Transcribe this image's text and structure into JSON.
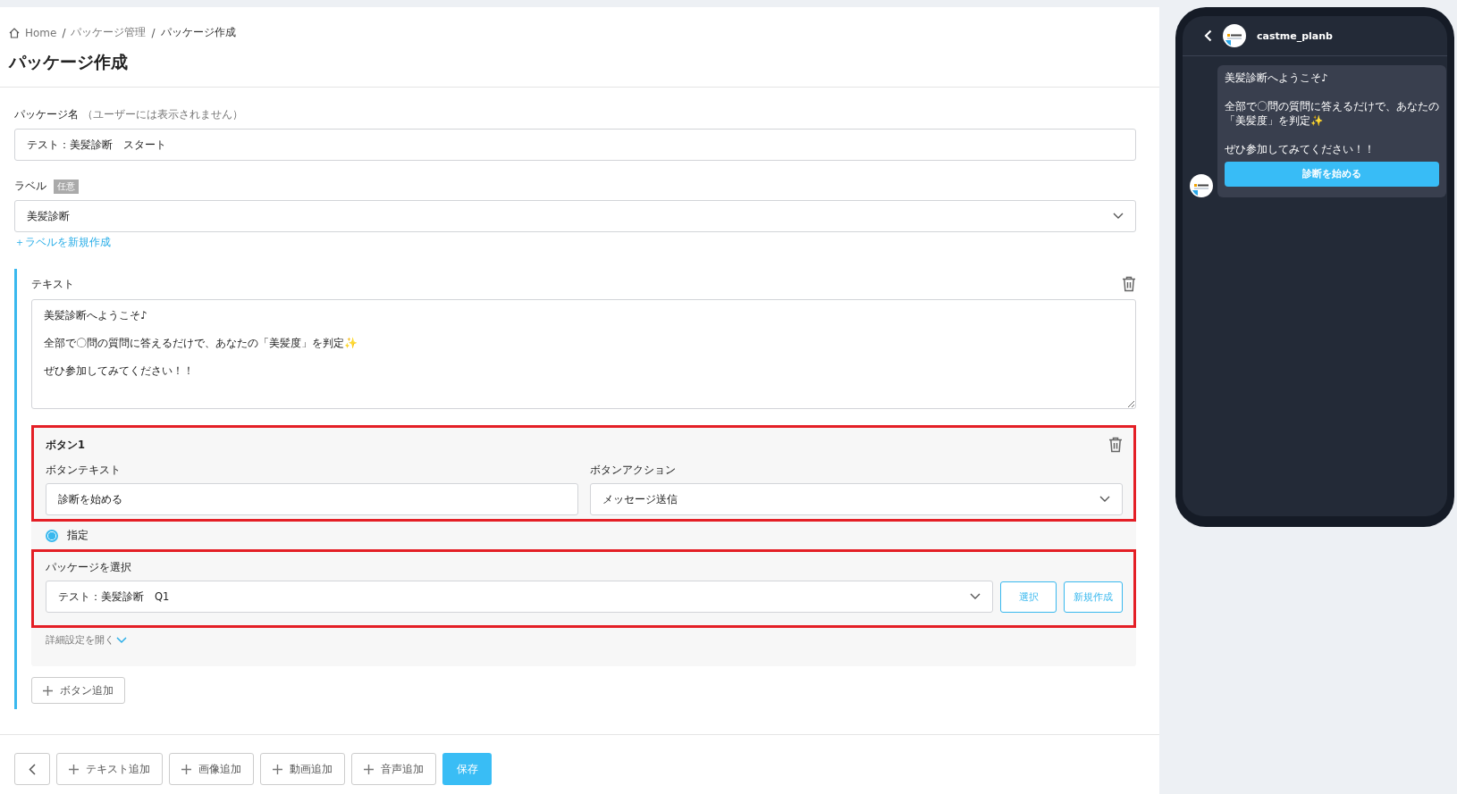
{
  "breadcrumb": [
    {
      "label": "Home"
    },
    {
      "separator": "/",
      "label": "パッケージ管理"
    },
    {
      "separator": "/",
      "label": "パッケージ作成"
    }
  ],
  "page_title": "パッケージ作成",
  "package_name": {
    "label": "パッケージ名",
    "hint": "（ユーザーには表示されません）",
    "value": "テスト：美髪診断　スタート"
  },
  "label_field": {
    "label": "ラベル",
    "badge": "任意",
    "value": "美髪診断",
    "create_link": "＋ラベルを新規作成"
  },
  "text_block": {
    "label": "テキスト",
    "value": "美髪診断へようこそ♪\n\n全部で〇問の質問に答えるだけで、あなたの「美髪度」を判定✨\n\nぜひ参加してみてください！！",
    "button_editor": {
      "title": "ボタン1",
      "highlighted": true,
      "text_label": "ボタンテキスト",
      "text_value": "診断を始める",
      "action_label": "ボタンアクション",
      "action_value": "メッセージ送信"
    },
    "radio": {
      "label": "指定",
      "selected": true
    },
    "package_select": {
      "highlighted": true,
      "label": "パッケージを選択",
      "value": "テスト：美髪診断　Q1",
      "buttons": [
        "選択",
        "新規作成"
      ]
    },
    "details_link": "詳細設定を開く",
    "add_button": "ボタン追加"
  },
  "footer": {
    "buttons": [
      "テキスト追加",
      "画像追加",
      "動画追加",
      "音声追加"
    ],
    "save": "保存"
  },
  "preview": {
    "account": "castme_planb",
    "message": [
      [
        "美髪診断へようこそ♪"
      ],
      [
        "全部で〇問の質問に答えるだけで、あなたの",
        "「美髪度」を判定✨"
      ],
      [
        "ぜひ参加してみてください！！"
      ]
    ],
    "button": "診断を始める"
  }
}
